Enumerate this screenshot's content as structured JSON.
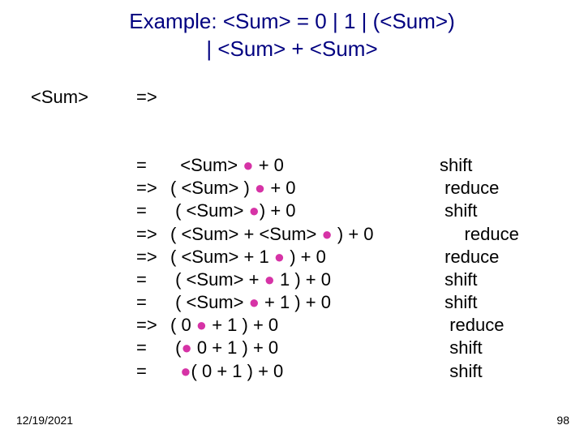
{
  "title_line1": "Example: <Sum> = 0 | 1 | (<Sum>)",
  "title_line2": "| <Sum> + <Sum>",
  "start": {
    "lhs": "<Sum>",
    "arrow": "=>"
  },
  "dot": "●",
  "deriv": [
    {
      "arrow": "=",
      "pre": "  <Sum> ",
      "post": " + 0",
      "action": "shift"
    },
    {
      "arrow": "=>",
      "pre": "( <Sum> ) ",
      "post": " + 0",
      "action": " reduce"
    },
    {
      "arrow": "=",
      "pre": " ( <Sum> ",
      "post": ") + 0",
      "action": " shift"
    },
    {
      "arrow": "=>",
      "pre": "( <Sum> + <Sum> ",
      "post": " ) + 0",
      "action": "     reduce"
    },
    {
      "arrow": "=>",
      "pre": "( <Sum> + 1 ",
      "post": " ) + 0",
      "action": " reduce"
    },
    {
      "arrow": "=",
      "pre": " ( <Sum> + ",
      "post": " 1 ) + 0",
      "action": " shift"
    },
    {
      "arrow": "=",
      "pre": " ( <Sum> ",
      "post": " + 1 ) + 0",
      "action": " shift"
    },
    {
      "arrow": "=>",
      "pre": "( 0 ",
      "post": " + 1 ) + 0",
      "action": "  reduce"
    },
    {
      "arrow": "=",
      "pre": " (",
      "post": " 0 + 1 ) + 0",
      "action": "  shift"
    },
    {
      "arrow": "=",
      "pre": "  ",
      "post": "( 0 + 1 ) + 0",
      "action": "  shift"
    }
  ],
  "footer": {
    "date": "12/19/2021",
    "page": "98"
  }
}
